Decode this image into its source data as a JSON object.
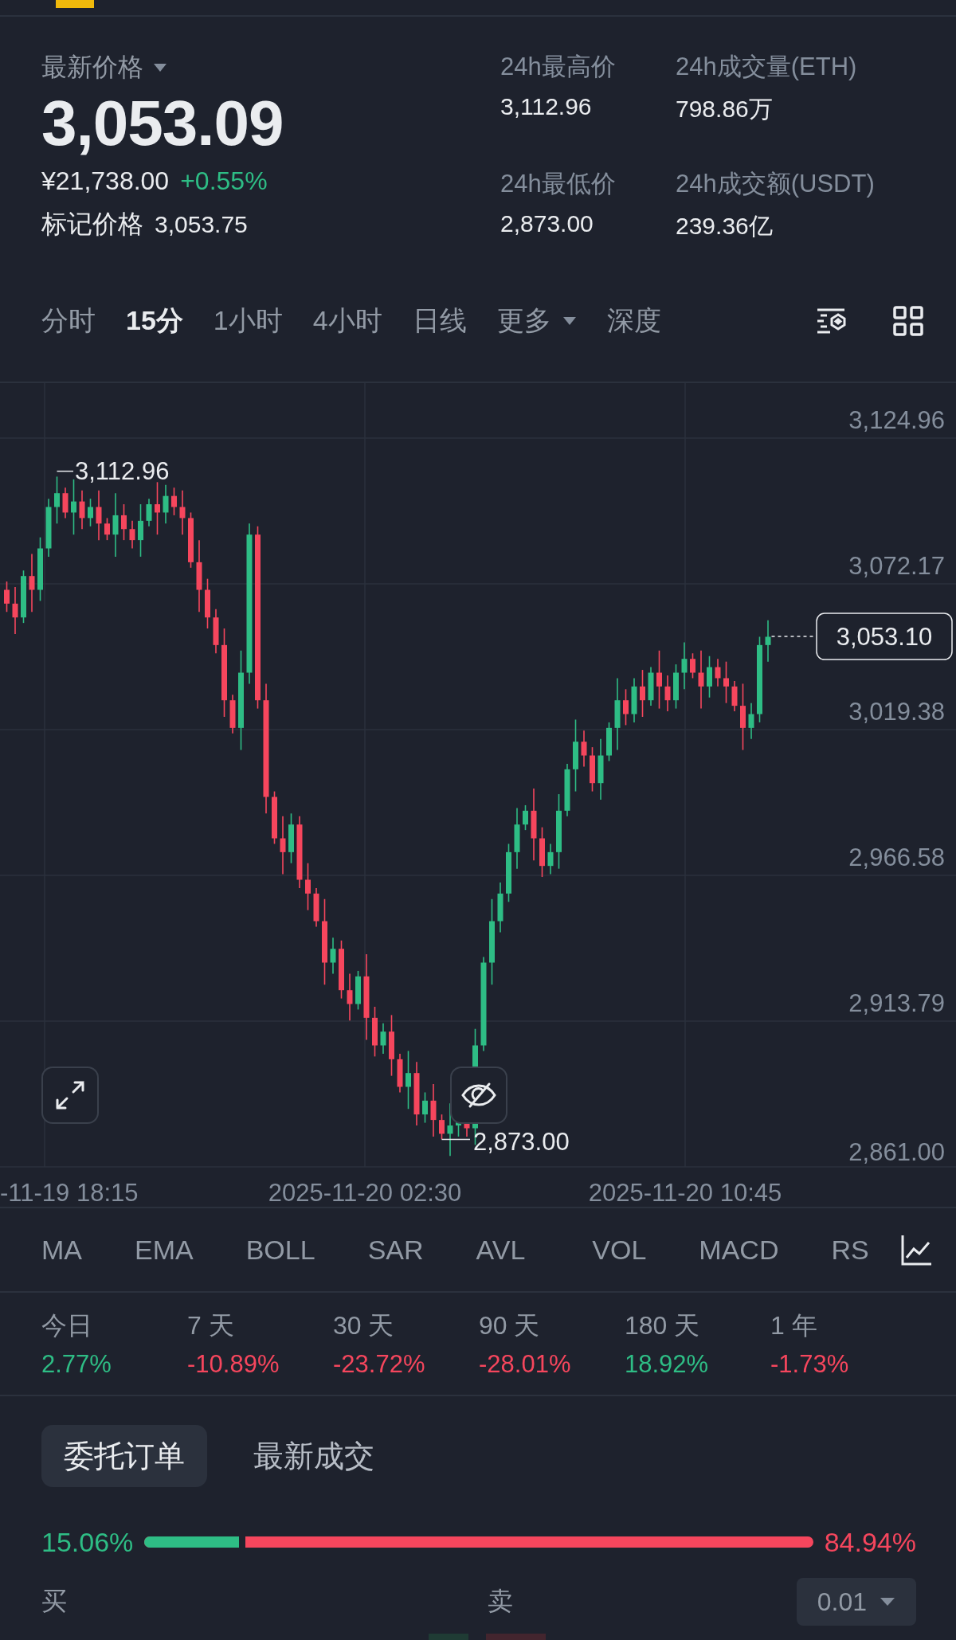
{
  "ticker": {
    "price_label": "最新价格",
    "last_price": "3,053.09",
    "cny_price": "¥21,738.00",
    "change": "+0.55%",
    "mark_price_label": "标记价格",
    "mark_price": "3,053.75"
  },
  "stats": [
    {
      "label": "24h最高价",
      "value": "3,112.96"
    },
    {
      "label": "24h成交量(ETH)",
      "value": "798.86万"
    },
    {
      "label": "24h最低价",
      "value": "2,873.00"
    },
    {
      "label": "24h成交额(USDT)",
      "value": "239.36亿"
    }
  ],
  "intervals": [
    {
      "label": "分时",
      "selected": false,
      "kind": "tab"
    },
    {
      "label": "15分",
      "selected": true,
      "kind": "tab"
    },
    {
      "label": "1小时",
      "selected": false,
      "kind": "tab"
    },
    {
      "label": "4小时",
      "selected": false,
      "kind": "tab"
    },
    {
      "label": "日线",
      "selected": false,
      "kind": "tab"
    },
    {
      "label": "更多",
      "selected": false,
      "kind": "dropdown"
    },
    {
      "label": "深度",
      "selected": false,
      "kind": "tab"
    }
  ],
  "chart": {
    "y_axis": [
      "3,124.96",
      "3,072.17",
      "3,019.38",
      "2,966.58",
      "2,913.79",
      "2,861.00"
    ],
    "x_axis": [
      "-11-19 18:15",
      "2025-11-20 02:30",
      "2025-11-20 10:45"
    ],
    "high_marker": "3,112.96",
    "low_marker": "2,873.00",
    "last_price_tag": "3,053.10"
  },
  "indicators": [
    {
      "label": "MA",
      "kind": "main"
    },
    {
      "label": "EMA",
      "kind": "main"
    },
    {
      "label": "BOLL",
      "kind": "main"
    },
    {
      "label": "SAR",
      "kind": "main"
    },
    {
      "label": "AVL",
      "kind": "main"
    },
    {
      "label": "VOL",
      "kind": "sub"
    },
    {
      "label": "MACD",
      "kind": "sub"
    },
    {
      "label": "RS",
      "kind": "sub"
    }
  ],
  "performance": [
    {
      "period": "今日",
      "value": "2.77%",
      "color": "#2ebd85"
    },
    {
      "period": "7 天",
      "value": "-10.89%",
      "color": "#f6465d"
    },
    {
      "period": "30 天",
      "value": "-23.72%",
      "color": "#f6465d"
    },
    {
      "period": "90 天",
      "value": "-28.01%",
      "color": "#f6465d"
    },
    {
      "period": "180 天",
      "value": "18.92%",
      "color": "#2ebd85"
    },
    {
      "period": "1 年",
      "value": "-1.73%",
      "color": "#f6465d"
    }
  ],
  "order_tabs": [
    {
      "label": "委托订单",
      "selected": true
    },
    {
      "label": "最新成交",
      "selected": false
    }
  ],
  "order_ratio": {
    "buy": "15.06%",
    "sell": "84.94%",
    "level": 0.1506
  },
  "book_header": {
    "buy": "买",
    "sell": "卖",
    "precision": "0.01"
  }
}
